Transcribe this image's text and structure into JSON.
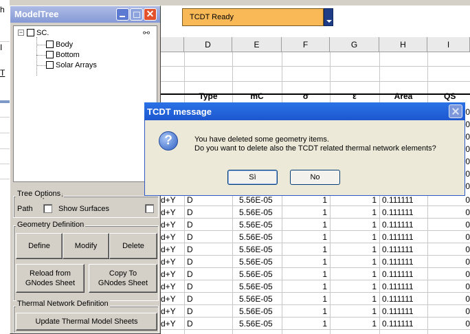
{
  "excel": {
    "status_text": "TCDT Ready",
    "columns": [
      "D",
      "E",
      "F",
      "G",
      "H",
      "I"
    ],
    "table_headers": [
      "Type",
      "mC",
      "σ",
      "ε",
      "Area",
      "QS"
    ],
    "row_prefix": "d+Y",
    "rows": [
      {
        "prefix": "d+Y",
        "type": "D",
        "mc": "5.56E-05",
        "sigma": "1",
        "eps": "1",
        "area": "0.111111",
        "qs": "0"
      },
      {
        "prefix": "d+Y",
        "type": "D",
        "mc": "5.56E-05",
        "sigma": "1",
        "eps": "1",
        "area": "0.111111",
        "qs": "0"
      },
      {
        "prefix": "d+Y",
        "type": "D",
        "mc": "5.56E-05",
        "sigma": "1",
        "eps": "1",
        "area": "0.111111",
        "qs": "0"
      },
      {
        "prefix": "d+Y",
        "type": "D",
        "mc": "5.56E-05",
        "sigma": "1",
        "eps": "1",
        "area": "0.111111",
        "qs": "0"
      },
      {
        "prefix": "d+Y",
        "type": "D",
        "mc": "5.56E-05",
        "sigma": "1",
        "eps": "1",
        "area": "0.111111",
        "qs": "0"
      },
      {
        "prefix": "d+Y",
        "type": "D",
        "mc": "5.56E-05",
        "sigma": "1",
        "eps": "1",
        "area": "0.111111",
        "qs": "0"
      },
      {
        "prefix": "d+Y",
        "type": "D",
        "mc": "5.56E-05",
        "sigma": "1",
        "eps": "1",
        "area": "0.111111",
        "qs": "0"
      },
      {
        "prefix": "d+Y",
        "type": "D",
        "mc": "5.56E-05",
        "sigma": "1",
        "eps": "1",
        "area": "0.111111",
        "qs": "0"
      },
      {
        "prefix": "d+Y",
        "type": "D",
        "mc": "5.56E-05",
        "sigma": "1",
        "eps": "1",
        "area": "0.111111",
        "qs": "0"
      },
      {
        "prefix": "d+Y",
        "type": "D",
        "mc": "5.56E-05",
        "sigma": "1",
        "eps": "1",
        "area": "0.111111",
        "qs": "0"
      },
      {
        "prefix": "d+Y",
        "type": "D",
        "mc": "5.56E-05",
        "sigma": "1",
        "eps": "1",
        "area": "0.111111",
        "qs": "0"
      }
    ],
    "qs_partial": [
      "0",
      "0",
      "0",
      "0",
      "0",
      "0",
      "0"
    ],
    "left_strip": [
      "h",
      "I",
      "T"
    ]
  },
  "model_tree": {
    "title": "ModelTree",
    "close_glyph": "✕",
    "root_label": "SC.",
    "expander": "−",
    "link_icon": "⚯",
    "items": [
      "Body",
      "Bottom",
      "Solar Arrays"
    ],
    "tree_options": {
      "label": "Tree Options",
      "path_label": "Path",
      "show_surfaces_label": "Show Surfaces"
    },
    "geometry_definition": {
      "label": "Geometry Definition",
      "define": "Define",
      "modify": "Modify",
      "delete": "Delete",
      "reload_line1": "Reload from",
      "reload_line2": "GNodes Sheet",
      "copy_line1": "Copy To",
      "copy_line2": "GNodes Sheet"
    },
    "thermal_network": {
      "label": "Thermal Network Definition",
      "update": "Update Thermal Model Sheets"
    }
  },
  "dialog": {
    "title": "TCDT message",
    "icon": "?",
    "line1": "You have deleted some geometry items.",
    "line2": "Do you want to delete also the TCDT related thermal network elements?",
    "yes": "Sì",
    "no": "No"
  }
}
